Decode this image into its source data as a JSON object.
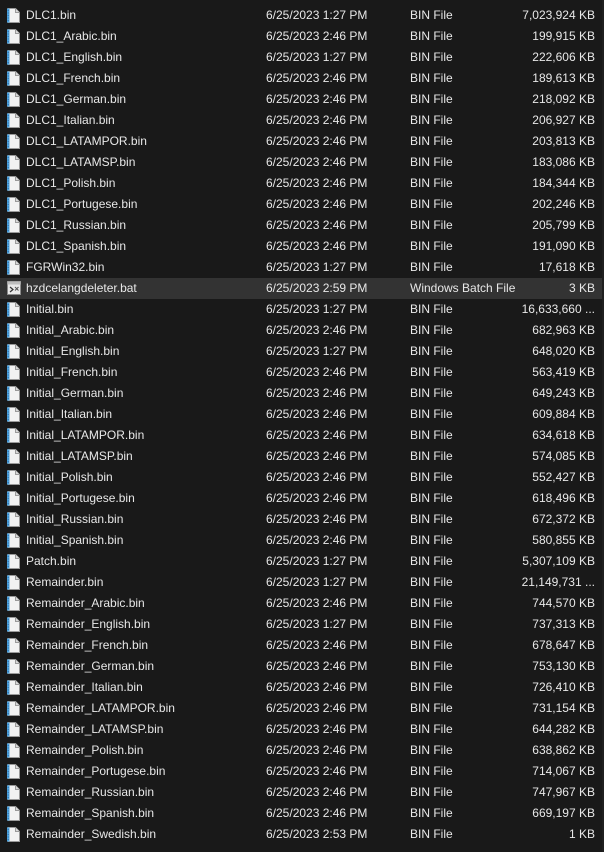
{
  "icon_names": {
    "bin": "bin-file-icon",
    "bat": "batch-file-icon"
  },
  "colors": {
    "background": "#191919",
    "selected_row": "#333333",
    "text": "#e8e8e8",
    "bin_icon_accent": "#4aa3df"
  },
  "files": [
    {
      "name": "DLC1.bin",
      "date": "6/25/2023 1:27 PM",
      "type": "BIN File",
      "size": "7,023,924 KB",
      "icon": "bin"
    },
    {
      "name": "DLC1_Arabic.bin",
      "date": "6/25/2023 2:46 PM",
      "type": "BIN File",
      "size": "199,915 KB",
      "icon": "bin"
    },
    {
      "name": "DLC1_English.bin",
      "date": "6/25/2023 1:27 PM",
      "type": "BIN File",
      "size": "222,606 KB",
      "icon": "bin"
    },
    {
      "name": "DLC1_French.bin",
      "date": "6/25/2023 2:46 PM",
      "type": "BIN File",
      "size": "189,613 KB",
      "icon": "bin"
    },
    {
      "name": "DLC1_German.bin",
      "date": "6/25/2023 2:46 PM",
      "type": "BIN File",
      "size": "218,092 KB",
      "icon": "bin"
    },
    {
      "name": "DLC1_Italian.bin",
      "date": "6/25/2023 2:46 PM",
      "type": "BIN File",
      "size": "206,927 KB",
      "icon": "bin"
    },
    {
      "name": "DLC1_LATAMPOR.bin",
      "date": "6/25/2023 2:46 PM",
      "type": "BIN File",
      "size": "203,813 KB",
      "icon": "bin"
    },
    {
      "name": "DLC1_LATAMSP.bin",
      "date": "6/25/2023 2:46 PM",
      "type": "BIN File",
      "size": "183,086 KB",
      "icon": "bin"
    },
    {
      "name": "DLC1_Polish.bin",
      "date": "6/25/2023 2:46 PM",
      "type": "BIN File",
      "size": "184,344 KB",
      "icon": "bin"
    },
    {
      "name": "DLC1_Portugese.bin",
      "date": "6/25/2023 2:46 PM",
      "type": "BIN File",
      "size": "202,246 KB",
      "icon": "bin"
    },
    {
      "name": "DLC1_Russian.bin",
      "date": "6/25/2023 2:46 PM",
      "type": "BIN File",
      "size": "205,799 KB",
      "icon": "bin"
    },
    {
      "name": "DLC1_Spanish.bin",
      "date": "6/25/2023 2:46 PM",
      "type": "BIN File",
      "size": "191,090 KB",
      "icon": "bin"
    },
    {
      "name": "FGRWin32.bin",
      "date": "6/25/2023 1:27 PM",
      "type": "BIN File",
      "size": "17,618 KB",
      "icon": "bin"
    },
    {
      "name": "hzdcelangdeleter.bat",
      "date": "6/25/2023 2:59 PM",
      "type": "Windows Batch File",
      "size": "3 KB",
      "icon": "bat",
      "selected": true
    },
    {
      "name": "Initial.bin",
      "date": "6/25/2023 1:27 PM",
      "type": "BIN File",
      "size": "16,633,660 ...",
      "icon": "bin"
    },
    {
      "name": "Initial_Arabic.bin",
      "date": "6/25/2023 2:46 PM",
      "type": "BIN File",
      "size": "682,963 KB",
      "icon": "bin"
    },
    {
      "name": "Initial_English.bin",
      "date": "6/25/2023 1:27 PM",
      "type": "BIN File",
      "size": "648,020 KB",
      "icon": "bin"
    },
    {
      "name": "Initial_French.bin",
      "date": "6/25/2023 2:46 PM",
      "type": "BIN File",
      "size": "563,419 KB",
      "icon": "bin"
    },
    {
      "name": "Initial_German.bin",
      "date": "6/25/2023 2:46 PM",
      "type": "BIN File",
      "size": "649,243 KB",
      "icon": "bin"
    },
    {
      "name": "Initial_Italian.bin",
      "date": "6/25/2023 2:46 PM",
      "type": "BIN File",
      "size": "609,884 KB",
      "icon": "bin"
    },
    {
      "name": "Initial_LATAMPOR.bin",
      "date": "6/25/2023 2:46 PM",
      "type": "BIN File",
      "size": "634,618 KB",
      "icon": "bin"
    },
    {
      "name": "Initial_LATAMSP.bin",
      "date": "6/25/2023 2:46 PM",
      "type": "BIN File",
      "size": "574,085 KB",
      "icon": "bin"
    },
    {
      "name": "Initial_Polish.bin",
      "date": "6/25/2023 2:46 PM",
      "type": "BIN File",
      "size": "552,427 KB",
      "icon": "bin"
    },
    {
      "name": "Initial_Portugese.bin",
      "date": "6/25/2023 2:46 PM",
      "type": "BIN File",
      "size": "618,496 KB",
      "icon": "bin"
    },
    {
      "name": "Initial_Russian.bin",
      "date": "6/25/2023 2:46 PM",
      "type": "BIN File",
      "size": "672,372 KB",
      "icon": "bin"
    },
    {
      "name": "Initial_Spanish.bin",
      "date": "6/25/2023 2:46 PM",
      "type": "BIN File",
      "size": "580,855 KB",
      "icon": "bin"
    },
    {
      "name": "Patch.bin",
      "date": "6/25/2023 1:27 PM",
      "type": "BIN File",
      "size": "5,307,109 KB",
      "icon": "bin"
    },
    {
      "name": "Remainder.bin",
      "date": "6/25/2023 1:27 PM",
      "type": "BIN File",
      "size": "21,149,731 ...",
      "icon": "bin"
    },
    {
      "name": "Remainder_Arabic.bin",
      "date": "6/25/2023 2:46 PM",
      "type": "BIN File",
      "size": "744,570 KB",
      "icon": "bin"
    },
    {
      "name": "Remainder_English.bin",
      "date": "6/25/2023 1:27 PM",
      "type": "BIN File",
      "size": "737,313 KB",
      "icon": "bin"
    },
    {
      "name": "Remainder_French.bin",
      "date": "6/25/2023 2:46 PM",
      "type": "BIN File",
      "size": "678,647 KB",
      "icon": "bin"
    },
    {
      "name": "Remainder_German.bin",
      "date": "6/25/2023 2:46 PM",
      "type": "BIN File",
      "size": "753,130 KB",
      "icon": "bin"
    },
    {
      "name": "Remainder_Italian.bin",
      "date": "6/25/2023 2:46 PM",
      "type": "BIN File",
      "size": "726,410 KB",
      "icon": "bin"
    },
    {
      "name": "Remainder_LATAMPOR.bin",
      "date": "6/25/2023 2:46 PM",
      "type": "BIN File",
      "size": "731,154 KB",
      "icon": "bin"
    },
    {
      "name": "Remainder_LATAMSP.bin",
      "date": "6/25/2023 2:46 PM",
      "type": "BIN File",
      "size": "644,282 KB",
      "icon": "bin"
    },
    {
      "name": "Remainder_Polish.bin",
      "date": "6/25/2023 2:46 PM",
      "type": "BIN File",
      "size": "638,862 KB",
      "icon": "bin"
    },
    {
      "name": "Remainder_Portugese.bin",
      "date": "6/25/2023 2:46 PM",
      "type": "BIN File",
      "size": "714,067 KB",
      "icon": "bin"
    },
    {
      "name": "Remainder_Russian.bin",
      "date": "6/25/2023 2:46 PM",
      "type": "BIN File",
      "size": "747,967 KB",
      "icon": "bin"
    },
    {
      "name": "Remainder_Spanish.bin",
      "date": "6/25/2023 2:46 PM",
      "type": "BIN File",
      "size": "669,197 KB",
      "icon": "bin"
    },
    {
      "name": "Remainder_Swedish.bin",
      "date": "6/25/2023 2:53 PM",
      "type": "BIN File",
      "size": "1 KB",
      "icon": "bin"
    }
  ]
}
